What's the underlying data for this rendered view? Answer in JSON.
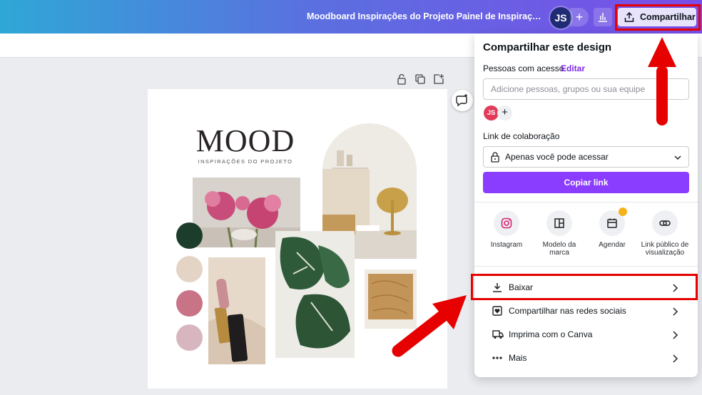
{
  "header": {
    "doc_title": "Moodboard Inspirações do Projeto Painel de Inspirações Po...",
    "avatar_initials": "JS",
    "add_icon": "plus-icon",
    "analytics_icon": "analytics-icon",
    "share_label": "Compartilhar",
    "share_icon": "upload-icon"
  },
  "canvas": {
    "mood_title": "MOOD",
    "mood_subtitle": "INSPIRAÇÕES DO PROJETO",
    "swatches": [
      "#1d3d2c",
      "#e3d4c6",
      "#c97386",
      "#d8b6c0"
    ]
  },
  "share_panel": {
    "title": "Compartilhar este design",
    "people_label": "Pessoas com acesso",
    "edit_link": "Editar",
    "people_placeholder": "Adicione pessoas, grupos ou sua equipe",
    "member_initials": "JS",
    "collab_label": "Link de colaboração",
    "access_value": "Apenas você pode acessar",
    "copy_link": "Copiar link",
    "options": [
      {
        "label": "Instagram",
        "icon": "instagram-icon"
      },
      {
        "label": "Modelo da marca",
        "icon": "brand-template-icon"
      },
      {
        "label": "Agendar",
        "icon": "calendar-icon"
      },
      {
        "label": "Link público de visualização",
        "icon": "link-icon"
      }
    ],
    "menu": [
      {
        "label": "Baixar",
        "icon": "download-icon"
      },
      {
        "label": "Compartilhar nas redes sociais",
        "icon": "heart-icon"
      },
      {
        "label": "Imprima com o Canva",
        "icon": "truck-icon"
      },
      {
        "label": "Mais",
        "icon": "more-icon"
      }
    ]
  },
  "colors": {
    "accent": "#8b3dff",
    "highlight": "#e60000"
  }
}
